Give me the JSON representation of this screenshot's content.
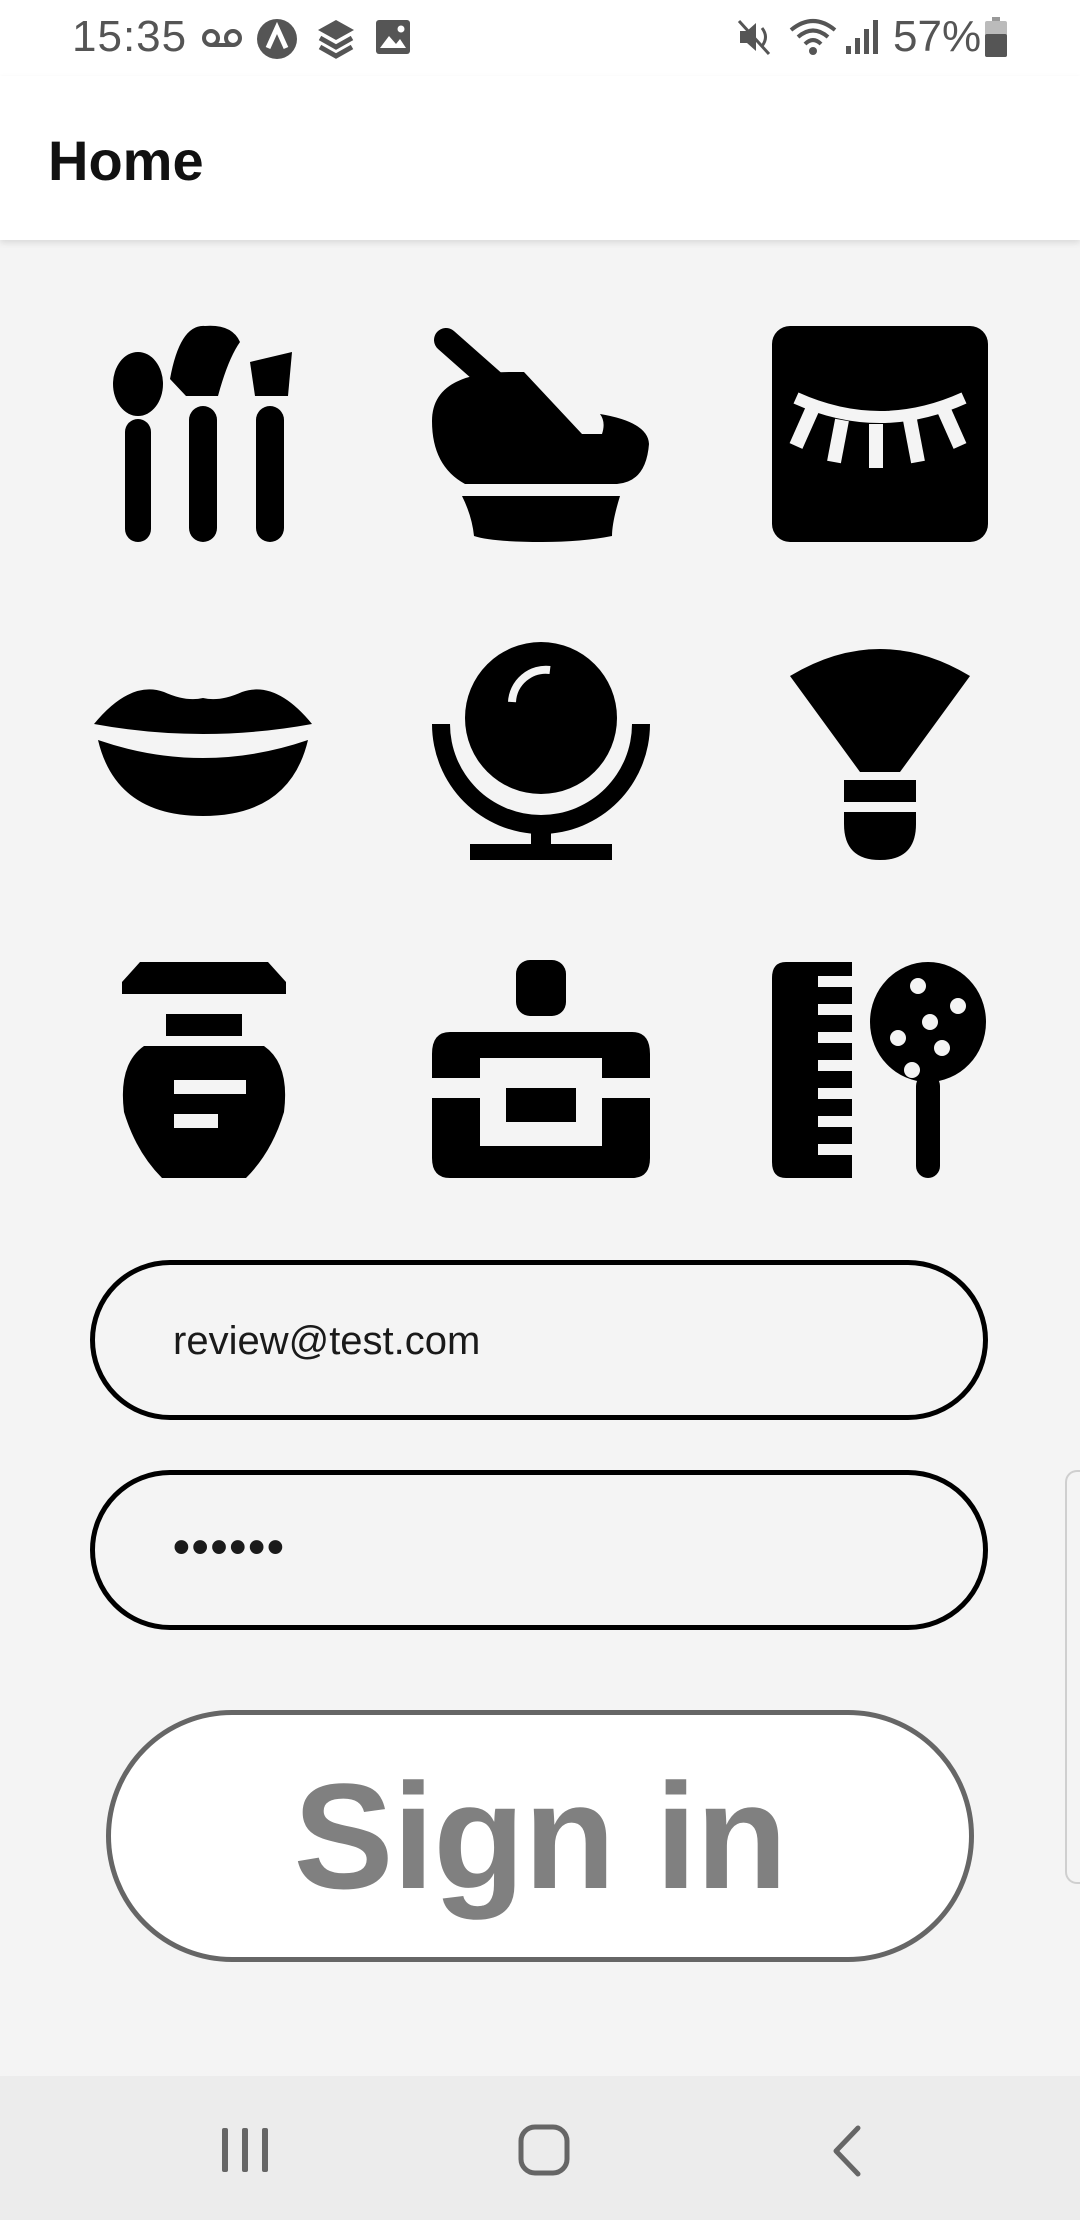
{
  "status_bar": {
    "time": "15:35",
    "battery": "57%",
    "icons": [
      "voicemail-icon",
      "app-a-icon",
      "layers-icon",
      "image-icon",
      "mute-icon",
      "wifi-icon",
      "signal-icon",
      "battery-icon"
    ]
  },
  "app_bar": {
    "title": "Home"
  },
  "icon_grid": [
    "makeup-brushes-icon",
    "mortar-pestle-icon",
    "eyelash-icon",
    "lips-icon",
    "vanity-mirror-icon",
    "fan-brush-icon",
    "perfume-bottle-icon",
    "vanity-case-icon",
    "comb-brush-icon"
  ],
  "login": {
    "email_value": "review@test.com",
    "password_mask": "••••••",
    "signin_label": "Sign in"
  },
  "nav_bar": {
    "icons": [
      "recent-apps-icon",
      "home-icon",
      "back-icon"
    ]
  },
  "colors": {
    "background": "#f4f4f4",
    "icon": "#000000",
    "button_text": "#808080"
  }
}
